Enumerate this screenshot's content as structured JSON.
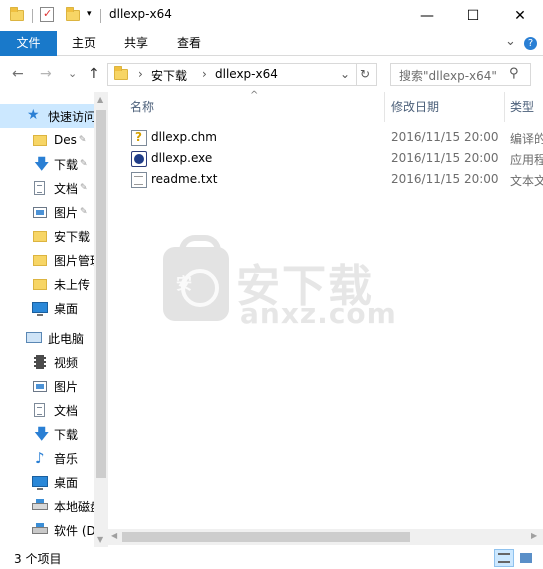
{
  "window": {
    "title": "dllexp-x64",
    "minimize": "—",
    "maximize": "☐",
    "close": "✕"
  },
  "ribbon": {
    "tabs": [
      "文件",
      "主页",
      "共享",
      "查看"
    ],
    "expand": "⌄",
    "help": "?"
  },
  "address": {
    "back": "←",
    "forward": "→",
    "recent": "⌄",
    "up": "↑",
    "crumb_sep": "›",
    "segments": [
      "安下载",
      "dllexp-x64"
    ],
    "dropdown": "⌄",
    "refresh": "↻"
  },
  "search": {
    "placeholder": "搜索\"dllexp-x64\"",
    "icon": "⚲"
  },
  "nav": {
    "items": [
      {
        "label": "快速访问",
        "icon": "star-icon"
      },
      {
        "label": "Des",
        "icon": "folder-icon",
        "pinned": true
      },
      {
        "label": "下载",
        "icon": "download-icon",
        "pinned": true
      },
      {
        "label": "文档",
        "icon": "document-icon",
        "pinned": true
      },
      {
        "label": "图片",
        "icon": "picture-icon",
        "pinned": true
      },
      {
        "label": "安下载",
        "icon": "folder-icon"
      },
      {
        "label": "图片管理",
        "icon": "folder-icon"
      },
      {
        "label": "未上传",
        "icon": "folder-icon"
      },
      {
        "label": "桌面",
        "icon": "desktop-icon"
      },
      {
        "label": "此电脑",
        "icon": "computer-icon"
      },
      {
        "label": "视频",
        "icon": "video-icon"
      },
      {
        "label": "图片",
        "icon": "picture-icon"
      },
      {
        "label": "文档",
        "icon": "document-icon"
      },
      {
        "label": "下载",
        "icon": "download-icon"
      },
      {
        "label": "音乐",
        "icon": "music-icon"
      },
      {
        "label": "桌面",
        "icon": "desktop-icon"
      },
      {
        "label": "本地磁盘",
        "icon": "drive-icon"
      },
      {
        "label": "软件 (D",
        "icon": "drive-icon"
      }
    ],
    "pin_glyph": "📌"
  },
  "columns": {
    "sort_glyph": "^",
    "name": "名称",
    "date": "修改日期",
    "type": "类型"
  },
  "files": [
    {
      "name": "dllexp.chm",
      "date": "2016/11/15 20:00",
      "type": "编译的"
    },
    {
      "name": "dllexp.exe",
      "date": "2016/11/15 20:00",
      "type": "应用程"
    },
    {
      "name": "readme.txt",
      "date": "2016/11/15 20:00",
      "type": "文本文"
    }
  ],
  "watermark": {
    "badge": "安",
    "title": "安下载",
    "sub": "anxz.com"
  },
  "status": {
    "count": "3 个项目"
  },
  "colors": {
    "accent": "#1979ca",
    "selection": "#cce8ff"
  }
}
